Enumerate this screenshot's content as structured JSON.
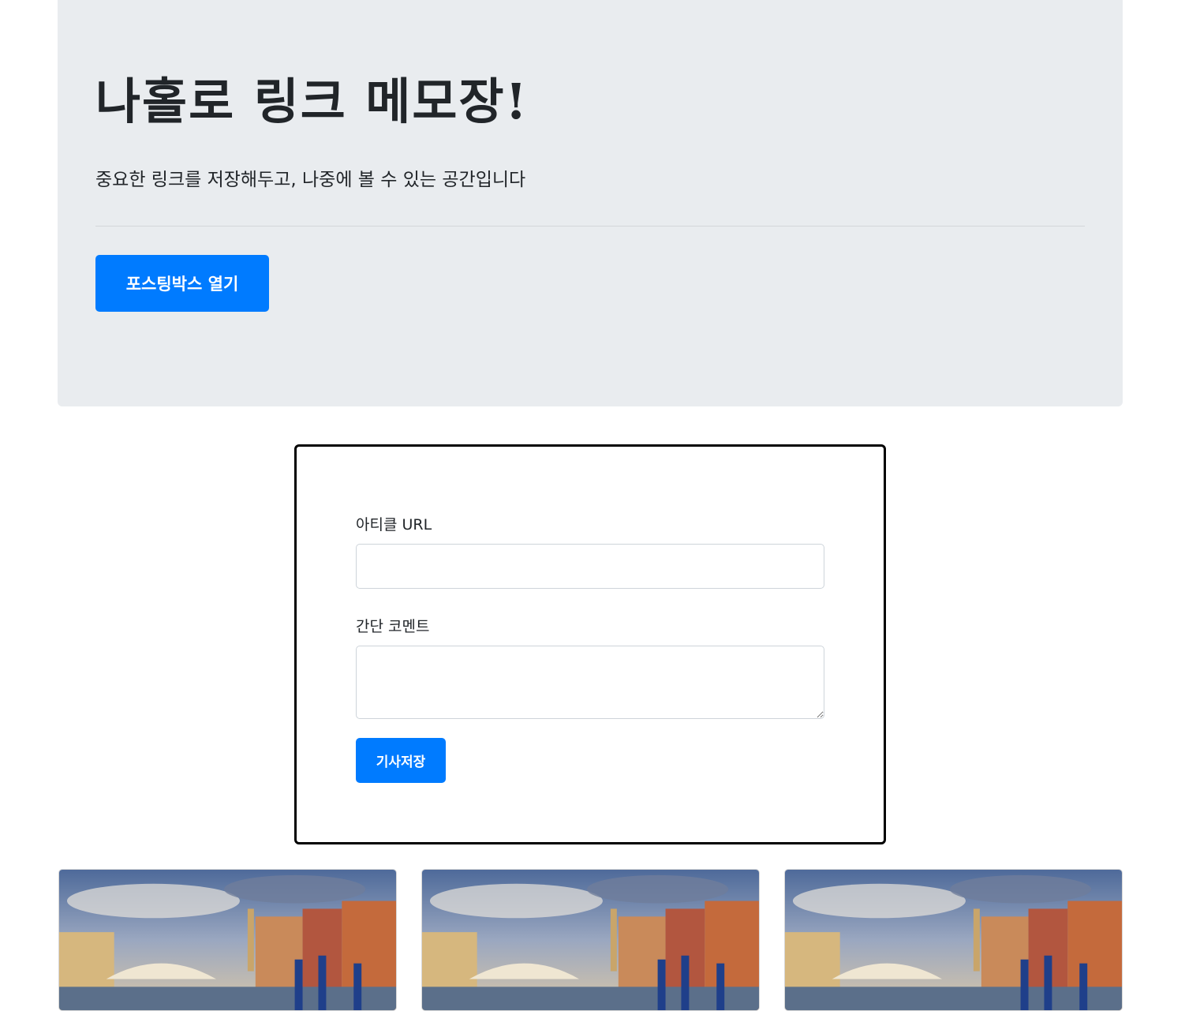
{
  "header": {
    "title": "나홀로 링크 메모장!",
    "subtitle": "중요한 링크를 저장해두고, 나중에 볼 수 있는 공간입니다",
    "open_button_label": "포스팅박스 열기"
  },
  "posting_box": {
    "url_label": "아티클 URL",
    "url_value": "",
    "comment_label": "간단 코멘트",
    "comment_value": "",
    "save_button_label": "기사저장"
  },
  "cards": [
    {
      "image": "venice-canal-photo"
    },
    {
      "image": "venice-canal-photo"
    },
    {
      "image": "venice-canal-photo"
    }
  ],
  "colors": {
    "primary": "#007bff",
    "jumbotron_bg": "#e9ecef",
    "text": "#212529"
  }
}
